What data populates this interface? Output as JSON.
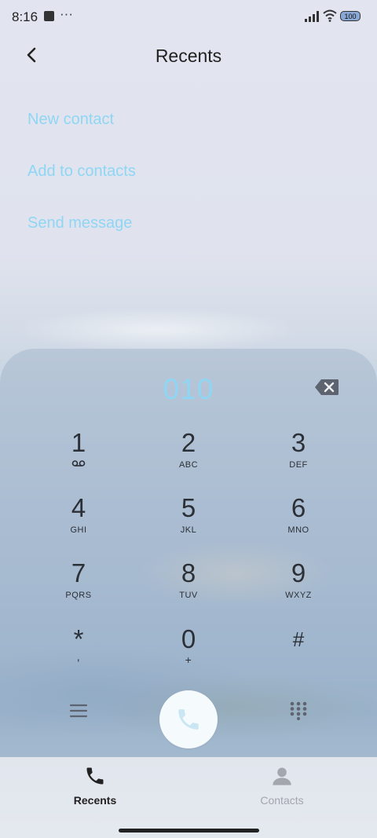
{
  "status_bar": {
    "time": "8:16",
    "more_indicator": "···",
    "battery_level": "100"
  },
  "header": {
    "title": "Recents",
    "back_icon": "chevron-left-icon"
  },
  "actions": [
    {
      "label": "New contact"
    },
    {
      "label": "Add to contacts"
    },
    {
      "label": "Send message"
    }
  ],
  "dialer": {
    "number": "010",
    "keys": [
      {
        "digit": "1",
        "letters": ""
      },
      {
        "digit": "2",
        "letters": "ABC"
      },
      {
        "digit": "3",
        "letters": "DEF"
      },
      {
        "digit": "4",
        "letters": "GHI"
      },
      {
        "digit": "5",
        "letters": "JKL"
      },
      {
        "digit": "6",
        "letters": "MNO"
      },
      {
        "digit": "7",
        "letters": "PQRS"
      },
      {
        "digit": "8",
        "letters": "TUV"
      },
      {
        "digit": "9",
        "letters": "WXYZ"
      },
      {
        "digit": "*",
        "letters": ","
      },
      {
        "digit": "0",
        "letters": "+"
      },
      {
        "digit": "#",
        "letters": ""
      }
    ]
  },
  "bottom_nav": {
    "items": [
      {
        "label": "Recents",
        "icon": "phone-icon",
        "active": true
      },
      {
        "label": "Contacts",
        "icon": "person-icon",
        "active": false
      }
    ]
  },
  "colors": {
    "accent": "#8fd6f4",
    "text": "#2b2f36",
    "inactive": "#a3a6ad"
  }
}
